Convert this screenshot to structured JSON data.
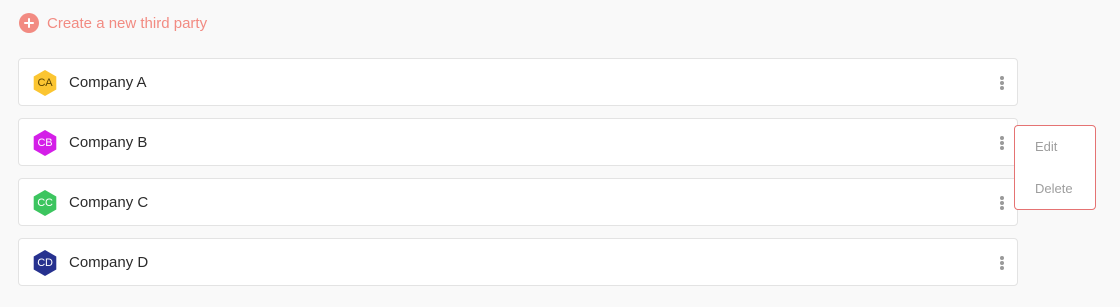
{
  "create_action": {
    "label": "Create a new third party",
    "icon": "plus-circle-icon",
    "color": "#f28b82"
  },
  "third_parties": [
    {
      "initials": "CA",
      "name": "Company A",
      "color": "#fbc531",
      "text_color": "#5a4300"
    },
    {
      "initials": "CB",
      "name": "Company B",
      "color": "#d41ee8",
      "text_color": "#ffffff"
    },
    {
      "initials": "CC",
      "name": "Company C",
      "color": "#3cc55f",
      "text_color": "#ffffff"
    },
    {
      "initials": "CD",
      "name": "Company D",
      "color": "#26318f",
      "text_color": "#ffffff"
    }
  ],
  "row_menu": {
    "open_for": "Company B",
    "items": [
      "Edit",
      "Delete"
    ],
    "border_color": "#e57373"
  }
}
